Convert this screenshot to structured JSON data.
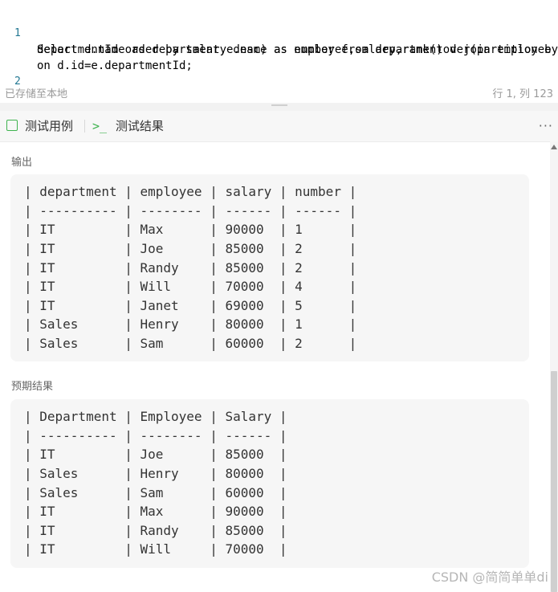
{
  "editor": {
    "line1_number": "1",
    "line2_number": "2",
    "line1_text": "Select d.name as department,e.name as employee,salary,rank()over(partition by",
    "line2_text": "departmentId order by salary desc) as number from department d join employee e",
    "line3_text": "on d.id=e.departmentId;"
  },
  "status": {
    "left": "已存储至本地",
    "right": "行 1, 列 123"
  },
  "tabs": {
    "test_cases": "测试用例",
    "test_result": "测试结果",
    "more": "···"
  },
  "output": {
    "title": "输出",
    "table_lines": [
      "| department | employee | salary | number |",
      "| ---------- | -------- | ------ | ------ |",
      "| IT         | Max      | 90000  | 1      |",
      "| IT         | Joe      | 85000  | 2      |",
      "| IT         | Randy    | 85000  | 2      |",
      "| IT         | Will     | 70000  | 4      |",
      "| IT         | Janet    | 69000  | 5      |",
      "| Sales      | Henry    | 80000  | 1      |",
      "| Sales      | Sam      | 60000  | 2      |"
    ]
  },
  "expected": {
    "title": "预期结果",
    "table_lines": [
      "| Department | Employee | Salary |",
      "| ---------- | -------- | ------ |",
      "| IT         | Joe      | 85000  |",
      "| Sales      | Henry    | 80000  |",
      "| Sales      | Sam      | 60000  |",
      "| IT         | Max      | 90000  |",
      "| IT         | Randy    | 85000  |",
      "| IT         | Will     | 70000  |"
    ]
  },
  "watermark": "CSDN @简简单单di",
  "colors": {
    "keyword": "#0000ff",
    "diff_red": "#e0474c",
    "diff_green": "#3eaf5a",
    "tab_accent": "#3fb34f"
  }
}
